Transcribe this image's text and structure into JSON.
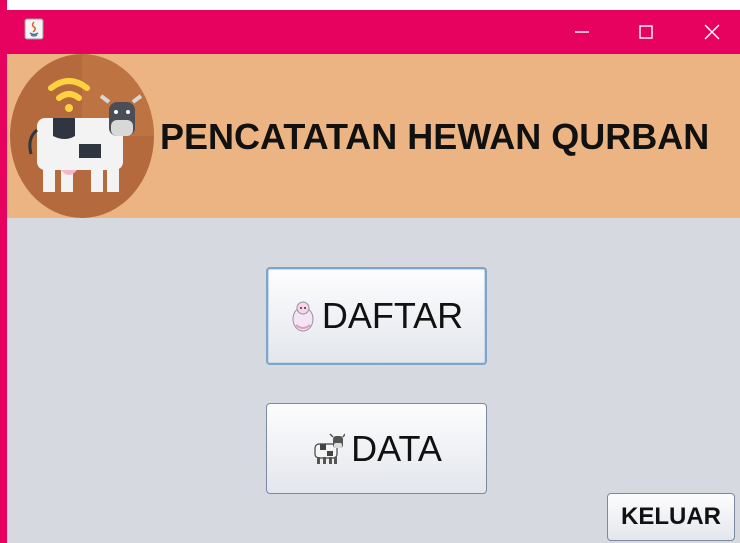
{
  "window": {
    "controls": [
      "minimize",
      "maximize",
      "close"
    ]
  },
  "header": {
    "title": "PENCATATAN HEWAN QURBAN",
    "logo_icon": "cow-wifi-icon"
  },
  "buttons": {
    "daftar": {
      "label": "DAFTAR",
      "icon": "sheep-icon"
    },
    "data": {
      "label": "DATA",
      "icon": "cow-icon"
    },
    "keluar": {
      "label": "KELUAR"
    }
  },
  "colors": {
    "titlebar": "#e8025f",
    "header": "#edb483",
    "body": "#d6d9e0",
    "logo_circle": "#b46a3c"
  }
}
